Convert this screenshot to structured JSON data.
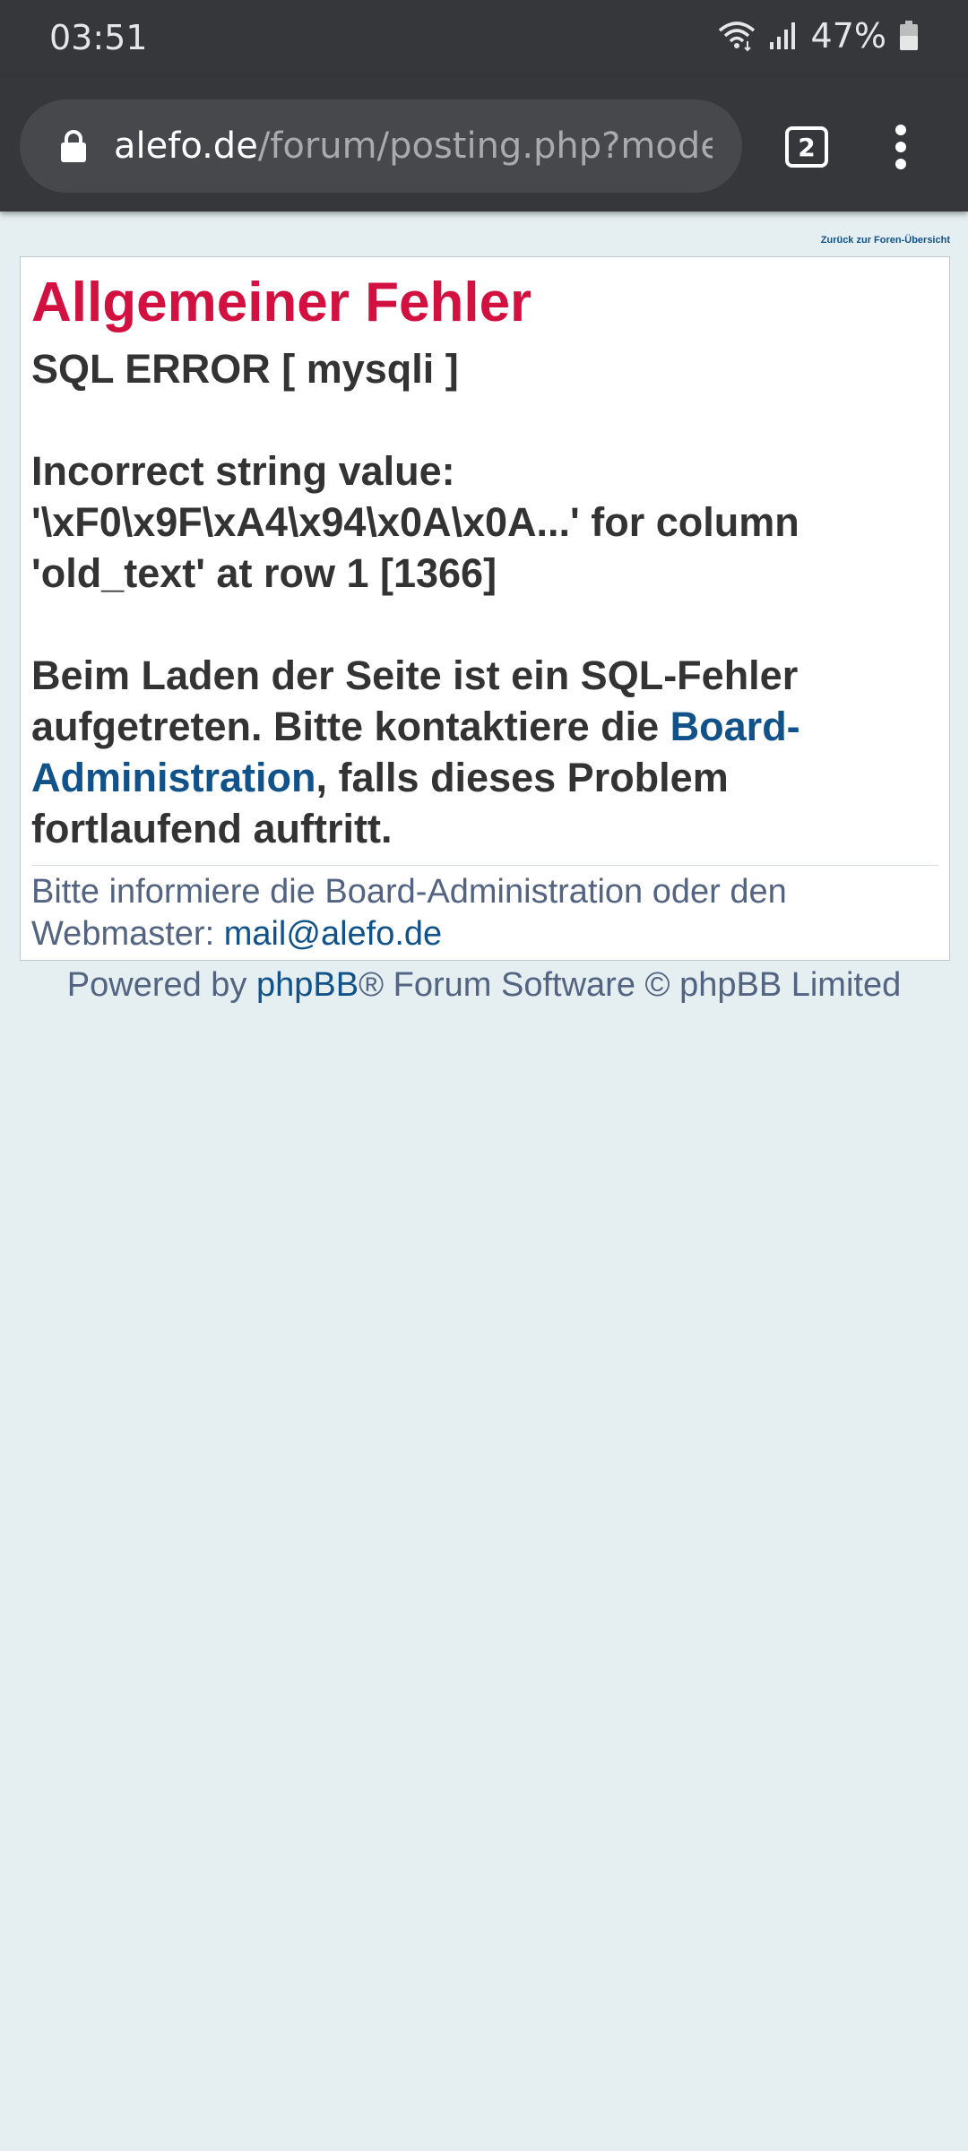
{
  "status_bar": {
    "time": "03:51",
    "battery": "47%",
    "icons": [
      "wifi-icon",
      "signal-icon",
      "battery-icon"
    ]
  },
  "browser": {
    "url_host": "alefo.de",
    "url_path": "/forum/posting.php?mode=edit",
    "tab_count": "2",
    "icons": [
      "lock-icon",
      "tabs-icon",
      "more-vert-icon"
    ]
  },
  "page": {
    "back_link": "Zurück zur Foren-Übersicht",
    "title": "Allgemeiner Fehler",
    "sql_error": "SQL ERROR [ mysqli ]",
    "message": "Incorrect string value: '\\xF0\\x9F\\xA4\\x94\\x0A\\x0A...' for column 'old_text' at row 1 [1366]",
    "notice_before": "Beim Laden der Seite ist ein SQL-Fehler aufgetreten. Bitte kontaktiere die ",
    "notice_link": "Board-Administration",
    "notice_after": ", falls dieses Problem fortlaufend auftritt.",
    "footer_text": "Bitte informiere die Board-Administration oder den Webmaster: ",
    "footer_email": "mail@alefo.de",
    "powered_before": "Powered by ",
    "powered_link": "phpBB",
    "powered_after": "® Forum Software © phpBB Limited"
  },
  "colors": {
    "title": "#d31141",
    "link": "#105289",
    "page_bg": "#e5eef1",
    "chrome_bg": "#35373a"
  }
}
